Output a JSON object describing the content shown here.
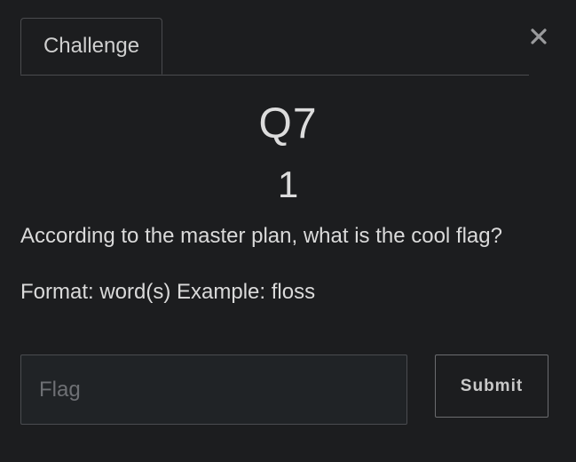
{
  "tabs": [
    {
      "label": "Challenge"
    }
  ],
  "close_icon": "close-icon",
  "challenge": {
    "name": "Q7",
    "value": "1",
    "description": "According to the master plan, what is the cool flag?",
    "format_hint": "Format: word(s) Example: floss"
  },
  "flag_input": {
    "placeholder": "Flag",
    "value": ""
  },
  "submit": {
    "label": "Submit"
  },
  "colors": {
    "background": "#1c1d1f",
    "text": "#dadada",
    "border": "#4a4b4e"
  }
}
